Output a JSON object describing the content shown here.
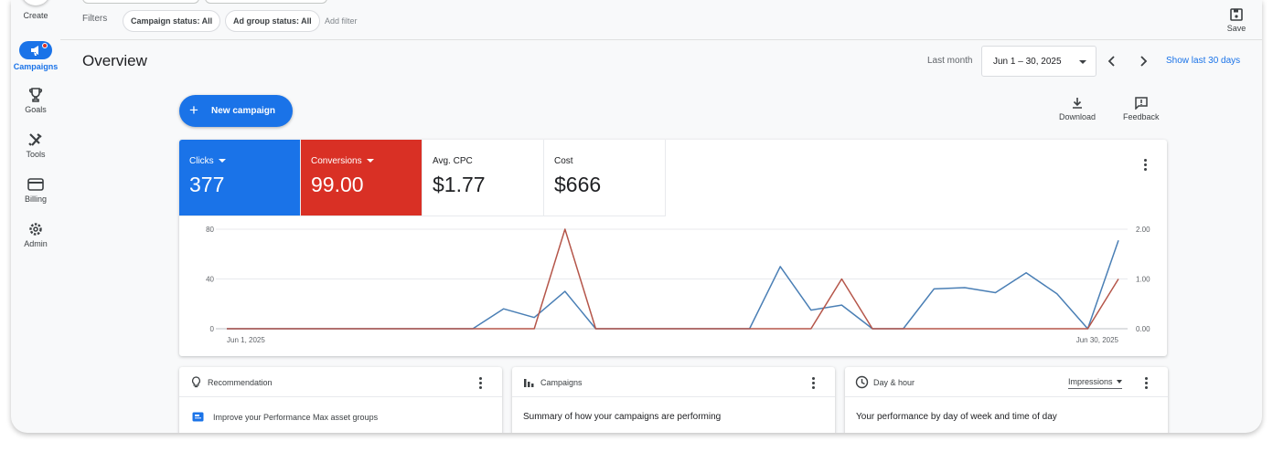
{
  "nav": {
    "create": "Create",
    "items": [
      {
        "label": "Campaigns",
        "icon": "campaigns-icon",
        "active": true
      },
      {
        "label": "Goals",
        "icon": "trophy-icon"
      },
      {
        "label": "Tools",
        "icon": "tools-icon"
      },
      {
        "label": "Billing",
        "icon": "credit-card-icon"
      },
      {
        "label": "Admin",
        "icon": "gear-icon"
      }
    ]
  },
  "filters": {
    "label": "Filters",
    "chips": [
      "Campaign status: All",
      "Ad group status: All"
    ],
    "add_filter": "Add filter"
  },
  "save_label": "Save",
  "page_title": "Overview",
  "date": {
    "preset": "Last month",
    "range": "Jun 1 – 30, 2025",
    "show_last": "Show last 30 days"
  },
  "new_campaign": "New campaign",
  "download": "Download",
  "feedback": "Feedback",
  "metrics": [
    {
      "label": "Clicks",
      "value": "377",
      "color": "#1a73e8"
    },
    {
      "label": "Conversions",
      "value": "99.00",
      "color": "#d93025"
    },
    {
      "label": "Avg. CPC",
      "value": "$1.77"
    },
    {
      "label": "Cost",
      "value": "$666"
    }
  ],
  "chart_data": {
    "type": "line",
    "x": [
      "Jun 1",
      "Jun 2",
      "Jun 3",
      "Jun 4",
      "Jun 5",
      "Jun 6",
      "Jun 7",
      "Jun 8",
      "Jun 9",
      "Jun 10",
      "Jun 11",
      "Jun 12",
      "Jun 13",
      "Jun 14",
      "Jun 15",
      "Jun 16",
      "Jun 17",
      "Jun 18",
      "Jun 19",
      "Jun 20",
      "Jun 21",
      "Jun 22",
      "Jun 23",
      "Jun 24",
      "Jun 25",
      "Jun 26",
      "Jun 27",
      "Jun 28",
      "Jun 29",
      "Jun 30"
    ],
    "x_tick_labels": [
      "Jun 1, 2025",
      "Jun 30, 2025"
    ],
    "y_left": {
      "lim": [
        0,
        80
      ],
      "ticks": [
        "0",
        "40",
        "80"
      ]
    },
    "y_right": {
      "lim": [
        0,
        2
      ],
      "ticks": [
        "0.00",
        "1.00",
        "2.00"
      ]
    },
    "series": [
      {
        "name": "Clicks",
        "axis": "left",
        "color": "#4a7fb5",
        "values": [
          0,
          0,
          0,
          0,
          0,
          0,
          0,
          0,
          0,
          16,
          9,
          30,
          0,
          0,
          0,
          0,
          0,
          0,
          50,
          15,
          19,
          0,
          0,
          32,
          33,
          29,
          45,
          28,
          0,
          71
        ]
      },
      {
        "name": "Conversions",
        "axis": "right",
        "color": "#b5564a",
        "values": [
          0,
          0,
          0,
          0,
          0,
          0,
          0,
          0,
          0,
          0,
          0,
          2,
          0,
          0,
          0,
          0,
          0,
          0,
          0,
          0,
          1,
          0,
          0,
          0,
          0,
          0,
          0,
          0,
          0,
          1
        ]
      }
    ],
    "grid": true
  },
  "cards": [
    {
      "title": "Recommendation",
      "icon": "lightbulb-icon",
      "body": "Improve your Performance Max asset groups"
    },
    {
      "title": "Campaigns",
      "icon": "bar-chart-icon",
      "body": "Summary of how your campaigns are performing"
    },
    {
      "title": "Day & hour",
      "icon": "clock-icon",
      "body": "Your performance by day of week and time of day",
      "select": "Impressions"
    }
  ]
}
